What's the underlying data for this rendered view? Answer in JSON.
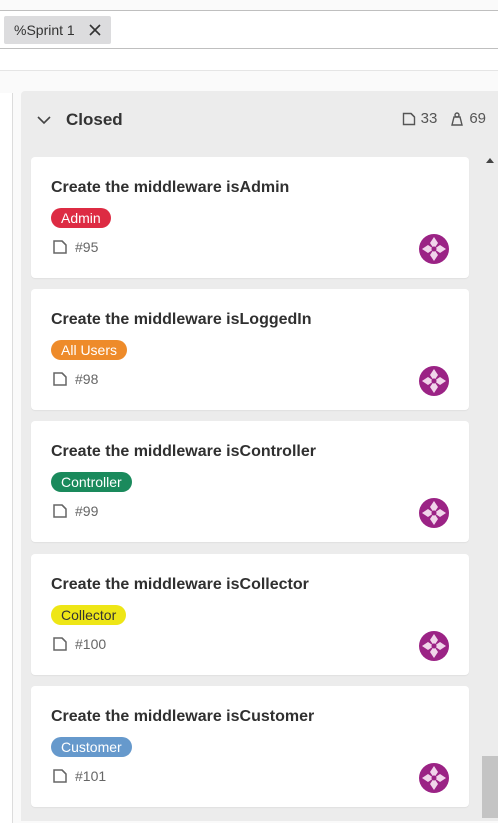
{
  "filter": {
    "token": "%Sprint 1"
  },
  "board": {
    "title": "Closed",
    "issue_count": "33",
    "weight_count": "69"
  },
  "colors": {
    "admin": "#dd2b43",
    "all_users": "#ee8b2a",
    "controller": "#1a8a5c",
    "collector": "#eee616",
    "customer": "#6699cc",
    "avatar": "#9b2385"
  },
  "cards": [
    {
      "title": "Create the middleware isAdmin",
      "label": "Admin",
      "issue": "#95"
    },
    {
      "title": "Create the middleware isLoggedIn",
      "label": "All Users",
      "issue": "#98"
    },
    {
      "title": "Create the middleware isController",
      "label": "Controller",
      "issue": "#99"
    },
    {
      "title": "Create the middleware isCollector",
      "label": "Collector",
      "issue": "#100"
    },
    {
      "title": "Create the middleware isCustomer",
      "label": "Customer",
      "issue": "#101"
    }
  ]
}
